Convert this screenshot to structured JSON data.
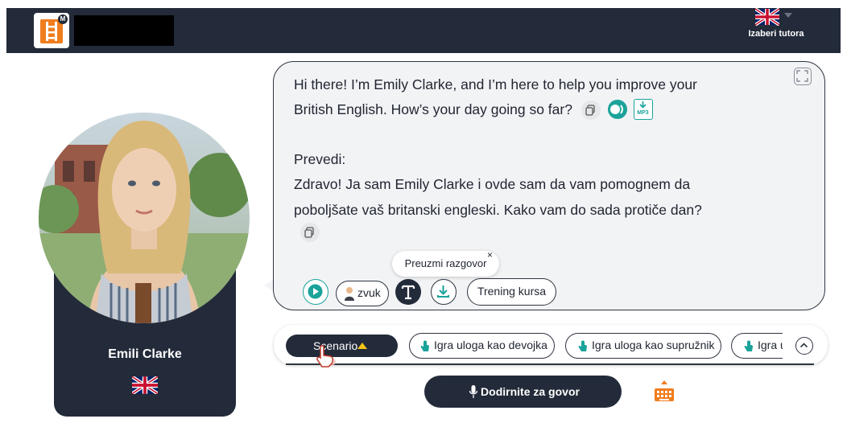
{
  "header": {
    "tutor_select_label": "Izaberi tutora",
    "flag_icon": "uk-flag-icon"
  },
  "profile": {
    "name": "Emili Clarke",
    "flag_icon": "uk-flag-icon"
  },
  "chat": {
    "message_line1": "Hi there! I’m Emily Clarke, and I’m here to help you improve your",
    "message_line2": "British English. How’s your day going so far?",
    "translate_heading": "Prevedi:",
    "translation_line1": "Zdravo! Ja sam Emily Clarke i ovde sam da vam pomognem da",
    "translation_line2": "poboljšate vaš britanski engleski. Kako vam do sada protiče dan?",
    "mp3_label": "MP3"
  },
  "toolbar": {
    "tooltip": "Preuzmi razgovor",
    "tooltip_close": "×",
    "sound_label": "zvuk",
    "course_label": "Trening kursa"
  },
  "scenarios": {
    "scenario_label": "Scenario",
    "roles": [
      "Igra uloga kao devojka",
      "Igra uloga kao supružnik",
      "Igra u"
    ]
  },
  "footer": {
    "speak_label": "Dodirnite za govor"
  },
  "colors": {
    "dark": "#232b3a",
    "accent_teal": "#1aa39a",
    "brand_orange": "#f07d1e",
    "scenario_arrow": "#f5c518"
  }
}
